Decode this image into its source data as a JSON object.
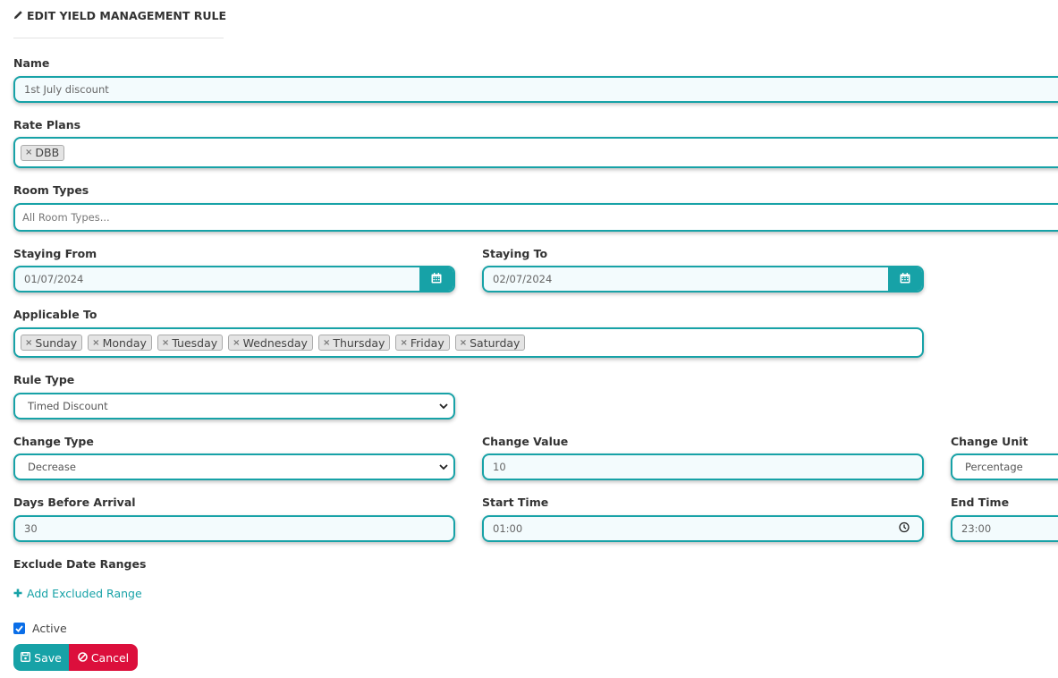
{
  "header": {
    "title": "EDIT YIELD MANAGEMENT RULE"
  },
  "form": {
    "name": {
      "label": "Name",
      "value": "1st July discount"
    },
    "rate_plans": {
      "label": "Rate Plans",
      "tags": [
        "DBB"
      ]
    },
    "room_types": {
      "label": "Room Types",
      "placeholder": "All Room Types..."
    },
    "staying_from": {
      "label": "Staying From",
      "value": "01/07/2024"
    },
    "staying_to": {
      "label": "Staying To",
      "value": "02/07/2024"
    },
    "applicable_to": {
      "label": "Applicable To",
      "tags": [
        "Sunday",
        "Monday",
        "Tuesday",
        "Wednesday",
        "Thursday",
        "Friday",
        "Saturday"
      ]
    },
    "rule_type": {
      "label": "Rule Type",
      "value": "Timed Discount"
    },
    "change_type": {
      "label": "Change Type",
      "value": "Decrease"
    },
    "change_value": {
      "label": "Change Value",
      "value": "10"
    },
    "change_unit": {
      "label": "Change Unit",
      "value": "Percentage"
    },
    "days_before_arrival": {
      "label": "Days Before Arrival",
      "value": "30"
    },
    "start_time": {
      "label": "Start Time",
      "value": "01:00"
    },
    "end_time": {
      "label": "End Time",
      "value": "23:00"
    },
    "exclude_date_ranges": {
      "label": "Exclude Date Ranges",
      "add_link": "Add Excluded Range"
    },
    "active": {
      "label": "Active",
      "checked": true
    }
  },
  "actions": {
    "save_label": "Save",
    "cancel_label": "Cancel"
  },
  "colors": {
    "accent": "#17a2a7",
    "danger": "#dc0f3c",
    "checkbox": "#0a6ee8"
  },
  "icons": [
    "pencil-icon",
    "remove-tag-icon",
    "calendar-icon",
    "chevron-down-icon",
    "clock-icon",
    "plus-icon",
    "check-icon",
    "save-icon",
    "ban-icon"
  ]
}
